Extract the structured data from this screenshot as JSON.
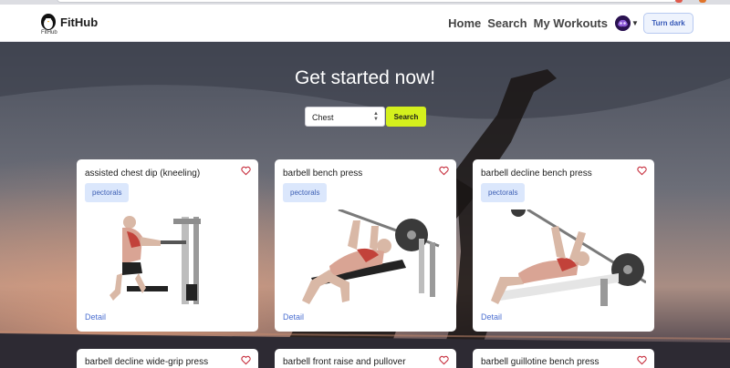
{
  "app": {
    "brand": "FitHub",
    "brand_sub": "FitHub"
  },
  "nav": {
    "links": [
      "Home",
      "Search",
      "My Workouts"
    ],
    "theme_button": "Turn dark"
  },
  "hero": {
    "title": "Get started now!",
    "select_value": "Chest",
    "search_button": "Search"
  },
  "cards": [
    {
      "title": "assisted chest dip (kneeling)",
      "tag": "pectorals",
      "detail": "Detail"
    },
    {
      "title": "barbell bench press",
      "tag": "pectorals",
      "detail": "Detail"
    },
    {
      "title": "barbell decline bench press",
      "tag": "pectorals",
      "detail": "Detail"
    },
    {
      "title": "barbell decline wide-grip press",
      "tag": "",
      "detail": ""
    },
    {
      "title": "barbell front raise and pullover",
      "tag": "",
      "detail": ""
    },
    {
      "title": "barbell guillotine bench press",
      "tag": "",
      "detail": ""
    }
  ],
  "colors": {
    "accent": "#d4f01d",
    "tag_bg": "#dbe7fc",
    "link": "#4b6fd1"
  }
}
